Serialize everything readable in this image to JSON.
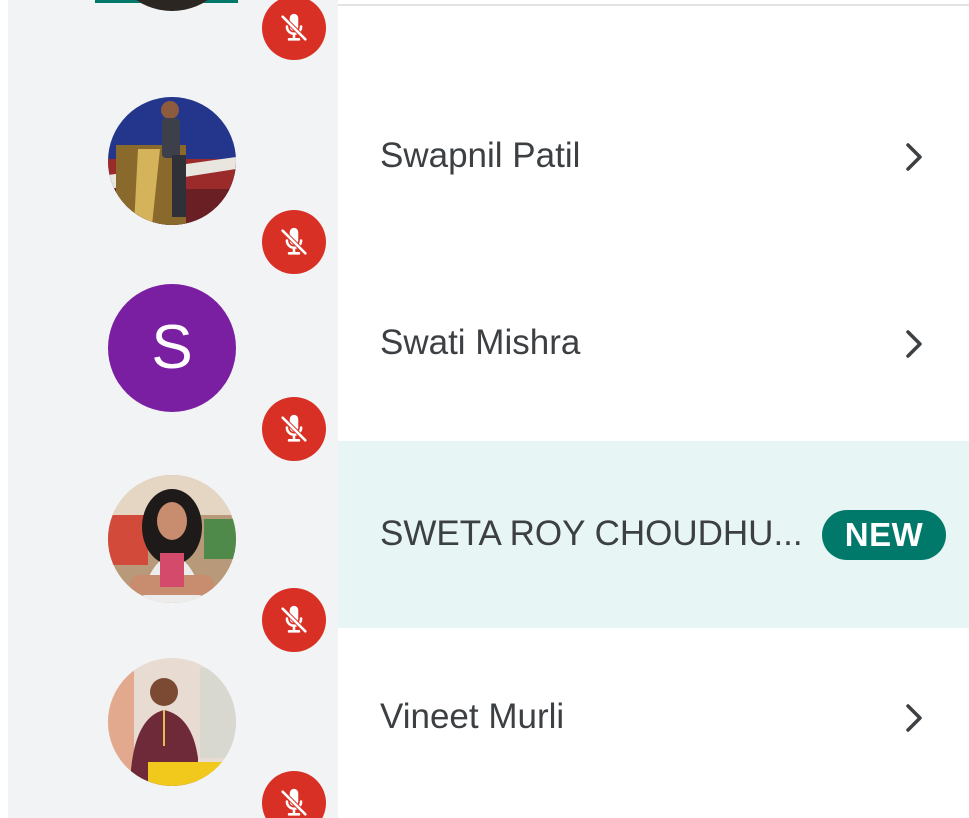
{
  "participants": [
    {
      "name": "",
      "avatar": "photo-partial",
      "mic": "mic-off-icon"
    },
    {
      "name": "Swapnil Patil",
      "avatar": "photo",
      "mic": "mic-off-icon"
    },
    {
      "name": "Swati Mishra",
      "avatar_letter": "S",
      "avatar_color": "#7b1fa2",
      "mic": "mic-off-icon"
    },
    {
      "name": "SWETA ROY CHOUDHU...",
      "avatar": "photo",
      "badge": "NEW",
      "highlighted": true,
      "mic": "mic-off-icon"
    },
    {
      "name": "Vineet Murli",
      "avatar": "photo",
      "mic": "mic-off-icon"
    }
  ],
  "colors": {
    "accent": "#00796b",
    "mute": "#d93025",
    "highlight": "#e7f5f4",
    "sidebar": "#f1f3f4",
    "text": "#3c4043"
  }
}
